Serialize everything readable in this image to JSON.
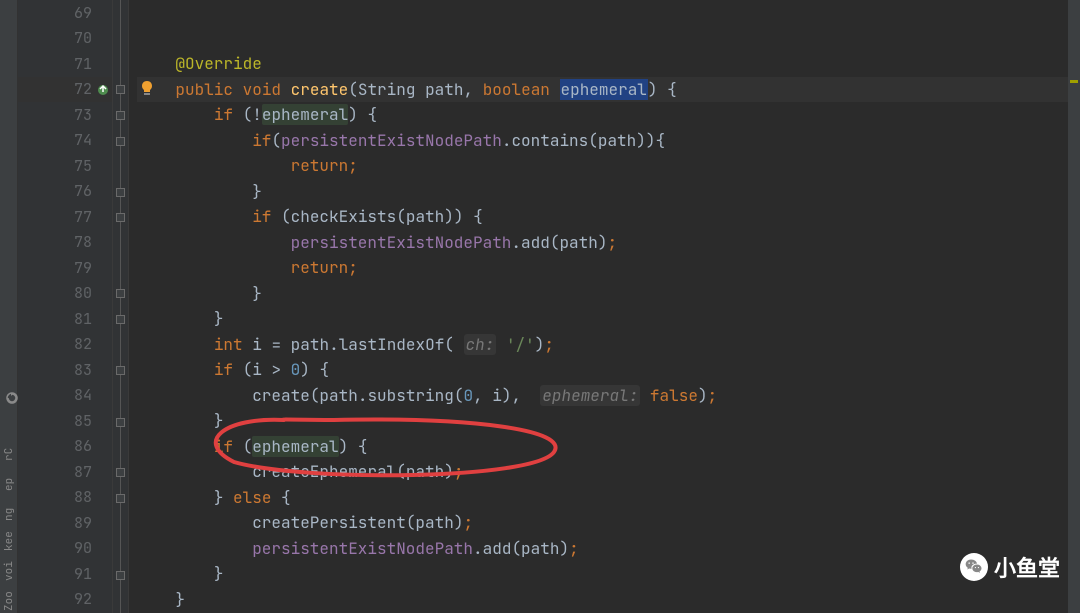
{
  "gutter": {
    "lines": [
      69,
      70,
      71,
      72,
      73,
      74,
      75,
      76,
      77,
      78,
      79,
      80,
      81,
      82,
      83,
      84,
      85,
      86,
      87,
      88,
      89,
      90,
      91,
      92
    ],
    "current_line": 72
  },
  "sidebar": {
    "tabs": [
      "rC",
      "ep",
      "ng",
      "kee",
      "voi",
      "Zoo"
    ]
  },
  "code": {
    "l69": "",
    "l70": "",
    "l71_annotation": "@Override",
    "l72_public": "public",
    "l72_void": "void",
    "l72_create": "create",
    "l72_string": "String",
    "l72_path": "path",
    "l72_boolean": "boolean",
    "l72_ephemeral": "ephemeral",
    "l73_if": "if",
    "l73_ephemeral": "ephemeral",
    "l74_if": "if",
    "l74_field": "persistentExistNodePath",
    "l74_contains": "contains",
    "l74_path": "path",
    "l75_return": "return",
    "l77_if": "if",
    "l77_check": "checkExists",
    "l77_path": "path",
    "l78_field": "persistentExistNodePath",
    "l78_add": "add",
    "l78_path": "path",
    "l79_return": "return",
    "l82_int": "int",
    "l82_i": "i",
    "l82_path": "path",
    "l82_lastindex": "lastIndexOf",
    "l82_hint": "ch:",
    "l82_str": "'/'",
    "l83_if": "if",
    "l83_i": "i",
    "l83_zero": "0",
    "l84_create": "create",
    "l84_path": "path",
    "l84_substring": "substring",
    "l84_zero": "0",
    "l84_i": "i",
    "l84_hint": "ephemeral:",
    "l84_false": "false",
    "l86_if": "if",
    "l86_ephemeral": "ephemeral",
    "l87_createeph": "createEphemeral",
    "l87_path": "path",
    "l88_else": "else",
    "l89_createper": "createPersistent",
    "l89_path": "path",
    "l90_field": "persistentExistNodePath",
    "l90_add": "add",
    "l90_path": "path"
  },
  "watermark": {
    "text": "小鱼堂"
  }
}
